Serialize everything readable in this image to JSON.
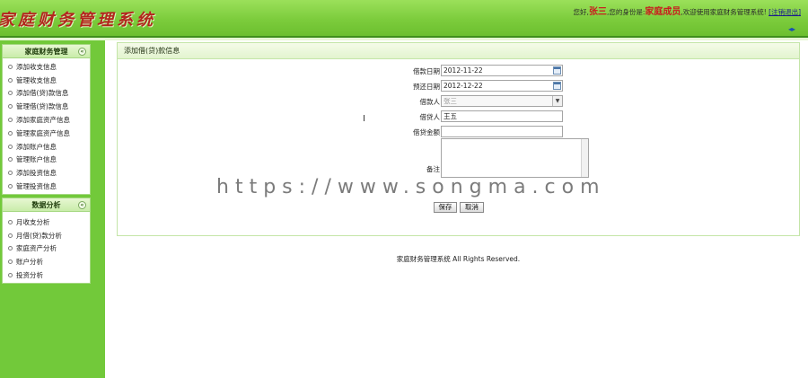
{
  "header": {
    "logo_text": "家庭财务管理系统",
    "greeting_prefix": "您好,",
    "user_name": "张三",
    "identity_prefix": ",您的身份是:",
    "role": "家庭成员",
    "welcome": ",欢迎使用家庭财务管理系统!",
    "logout_label": "[注销退出]",
    "nav_arrows": "◂▸"
  },
  "sidebar": {
    "finance_panel": {
      "title": "家庭财务管理",
      "toggle": "«",
      "items": [
        {
          "label": "添加收支信息"
        },
        {
          "label": "管理收支信息"
        },
        {
          "label": "添加借(贷)款信息"
        },
        {
          "label": "管理借(贷)款信息"
        },
        {
          "label": "添加家庭资产信息"
        },
        {
          "label": "管理家庭资产信息"
        },
        {
          "label": "添加账户信息"
        },
        {
          "label": "管理账户信息"
        },
        {
          "label": "添加投资信息"
        },
        {
          "label": "管理投资信息"
        }
      ]
    },
    "analysis_panel": {
      "title": "数据分析",
      "toggle": "«",
      "items": [
        {
          "label": "月收支分析"
        },
        {
          "label": "月借(贷)款分析"
        },
        {
          "label": "家庭资产分析"
        },
        {
          "label": "账户分析"
        },
        {
          "label": "投资分析"
        }
      ]
    }
  },
  "main": {
    "title": "添加借(贷)款信息",
    "form": {
      "loan_date_label": "借款日期",
      "loan_date_value": "2012-11-22",
      "return_date_label": "预还日期",
      "return_date_value": "2012-12-22",
      "borrower_label": "借款人",
      "borrower_value": "张三",
      "lender_label": "借贷人",
      "lender_value": "王五",
      "amount_label": "借贷金额",
      "amount_value": "",
      "remark_label": "备注",
      "save_label": "保存",
      "cancel_label": "取消"
    }
  },
  "footer": {
    "text": "家庭财务管理系统 All Rights Reserved."
  },
  "watermark": {
    "text": "https://www.songma.com"
  }
}
